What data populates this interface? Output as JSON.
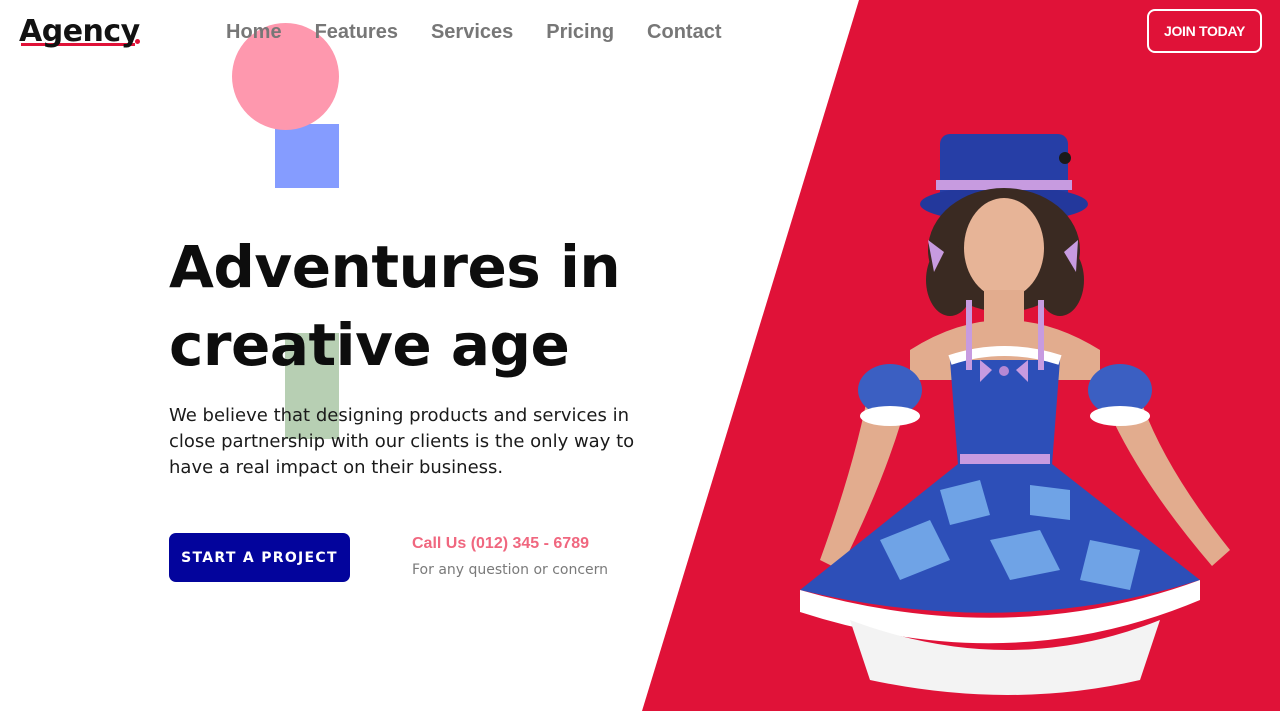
{
  "brand": {
    "name": "Agency",
    "accent_color": "#e01238"
  },
  "nav": {
    "items": [
      {
        "label": "Home"
      },
      {
        "label": "Features"
      },
      {
        "label": "Services"
      },
      {
        "label": "Pricing"
      },
      {
        "label": "Contact"
      }
    ],
    "cta_label": "JOIN TODAY"
  },
  "hero": {
    "title_line1": "Adventures in",
    "title_line2": "creative age",
    "description": "We believe that designing products and services in close partnership with our clients is the only way to have a real impact on their business.",
    "primary_button": "START A PROJECT",
    "call_label": "Call Us (012) 345 - 6789",
    "call_sub": "For any question or concern",
    "image_alt": "Model in blue checkered costume dress and top hat",
    "colors": {
      "panel": "#e01238",
      "button": "#03049c",
      "call_text": "#f0677f",
      "deco_circle": "#fe98ae",
      "deco_square": "#859cff",
      "deco_bar": "#b7cfb3"
    }
  }
}
